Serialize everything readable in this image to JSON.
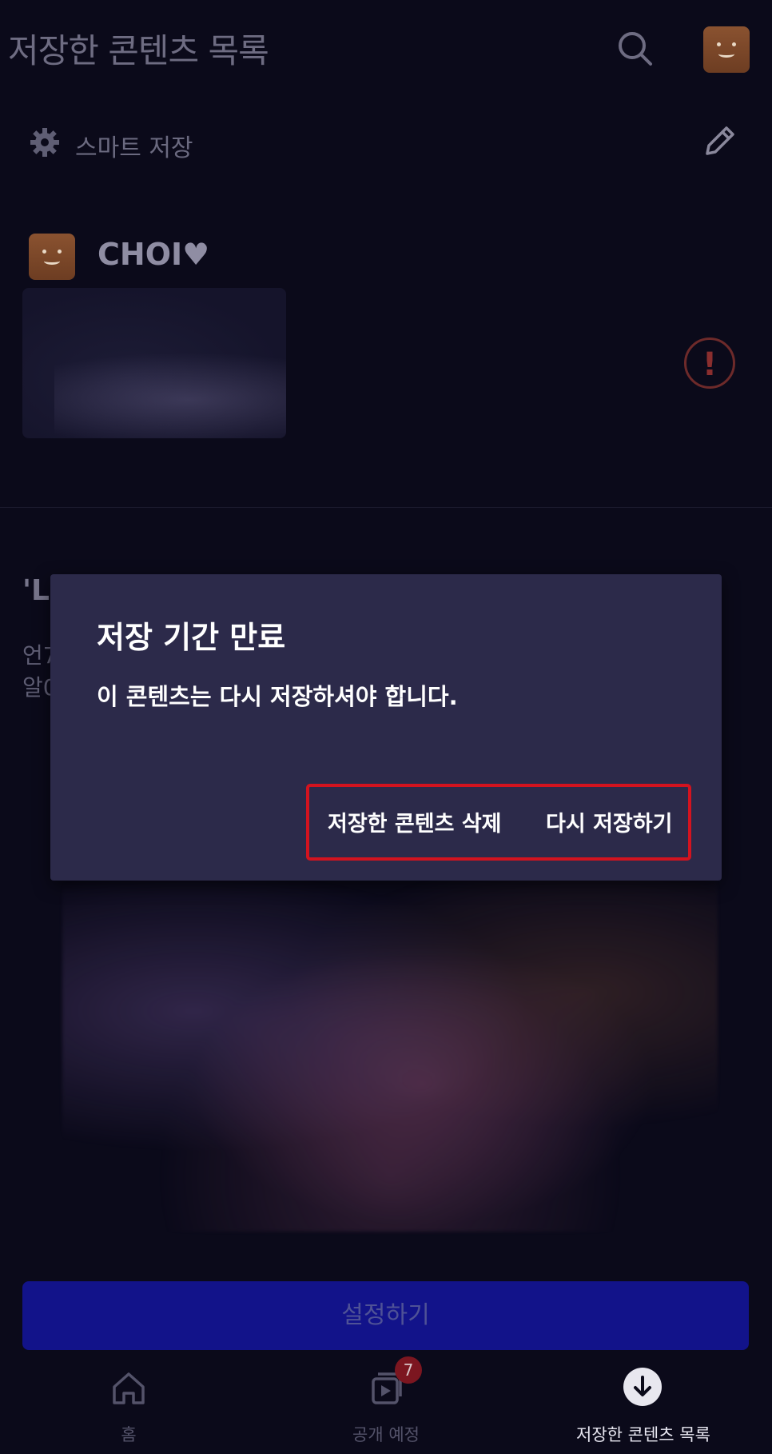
{
  "header": {
    "title": "저장한 콘텐츠 목록"
  },
  "smart_save": {
    "label": "스마트 저장"
  },
  "profile": {
    "name": "CHOI♥"
  },
  "section": {
    "heading": "'L",
    "description_lines": [
      "언7",
      "알0"
    ]
  },
  "dialog": {
    "title": "저장 기간 만료",
    "message": "이 콘텐츠는 다시 저장하셔야 합니다.",
    "delete_label": "저장한 콘텐츠 삭제",
    "resave_label": "다시 저장하기"
  },
  "setup_button": {
    "label": "설정하기"
  },
  "bottom_nav": {
    "items": [
      {
        "label": "홈",
        "icon": "home-icon"
      },
      {
        "label": "공개 예정",
        "icon": "coming-soon-icon",
        "badge": "7"
      },
      {
        "label": "저장한 콘텐츠 목록",
        "icon": "download-icon"
      }
    ]
  },
  "colors": {
    "accent": "#d3131f",
    "dialog_bg": "#2c2a4a",
    "setup_button": "#12138a"
  }
}
